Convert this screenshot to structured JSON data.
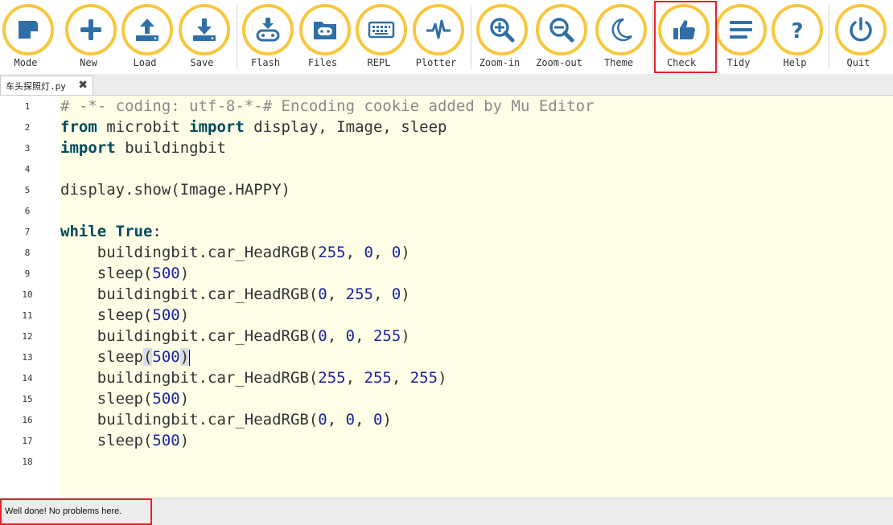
{
  "toolbar": {
    "buttons": [
      {
        "id": "mode",
        "label": "Mode",
        "icon": "mode-icon"
      },
      {
        "id": "new",
        "label": "New",
        "icon": "plus-icon"
      },
      {
        "id": "load",
        "label": "Load",
        "icon": "upload-icon"
      },
      {
        "id": "save",
        "label": "Save",
        "icon": "download-icon"
      },
      {
        "id": "flash",
        "label": "Flash",
        "icon": "flash-icon"
      },
      {
        "id": "files",
        "label": "Files",
        "icon": "folder-icon"
      },
      {
        "id": "repl",
        "label": "REPL",
        "icon": "keyboard-icon"
      },
      {
        "id": "plotter",
        "label": "Plotter",
        "icon": "pulse-icon"
      },
      {
        "id": "zoom-in",
        "label": "Zoom-in",
        "icon": "zoom-in-icon"
      },
      {
        "id": "zoom-out",
        "label": "Zoom-out",
        "icon": "zoom-out-icon"
      },
      {
        "id": "theme",
        "label": "Theme",
        "icon": "moon-icon"
      },
      {
        "id": "check",
        "label": "Check",
        "icon": "thumbs-up-icon"
      },
      {
        "id": "tidy",
        "label": "Tidy",
        "icon": "lines-icon"
      },
      {
        "id": "help",
        "label": "Help",
        "icon": "question-icon"
      },
      {
        "id": "quit",
        "label": "Quit",
        "icon": "power-icon"
      }
    ],
    "accent_color": "#f8c73d",
    "icon_color": "#2f6fa6",
    "highlight_color": "#e8202a"
  },
  "tab": {
    "filename": "车头探照灯.py",
    "close": "✖"
  },
  "editor": {
    "lines": [
      {
        "n": "1",
        "tokens": [
          {
            "t": "# -*- coding: utf-8-*-# Encoding cookie added by Mu Editor",
            "c": "cm"
          }
        ]
      },
      {
        "n": "2",
        "tokens": [
          {
            "t": "from",
            "c": "kw"
          },
          {
            "t": " microbit ",
            "c": ""
          },
          {
            "t": "import",
            "c": "kw"
          },
          {
            "t": " display, Image, sleep",
            "c": ""
          }
        ]
      },
      {
        "n": "3",
        "tokens": [
          {
            "t": "import",
            "c": "kw"
          },
          {
            "t": " buildingbit",
            "c": ""
          }
        ]
      },
      {
        "n": "4",
        "tokens": []
      },
      {
        "n": "5",
        "tokens": [
          {
            "t": "display.show(Image.HAPPY)",
            "c": ""
          }
        ]
      },
      {
        "n": "6",
        "tokens": []
      },
      {
        "n": "7",
        "tokens": [
          {
            "t": "while",
            "c": "kw"
          },
          {
            "t": " ",
            "c": ""
          },
          {
            "t": "True",
            "c": "kw"
          },
          {
            "t": ":",
            "c": ""
          }
        ]
      },
      {
        "n": "8",
        "tokens": [
          {
            "t": "    buildingbit.car_HeadRGB(",
            "c": ""
          },
          {
            "t": "255",
            "c": "num"
          },
          {
            "t": ", ",
            "c": ""
          },
          {
            "t": "0",
            "c": "num"
          },
          {
            "t": ", ",
            "c": ""
          },
          {
            "t": "0",
            "c": "num"
          },
          {
            "t": ")",
            "c": ""
          }
        ]
      },
      {
        "n": "9",
        "tokens": [
          {
            "t": "    sleep(",
            "c": ""
          },
          {
            "t": "500",
            "c": "num"
          },
          {
            "t": ")",
            "c": ""
          }
        ]
      },
      {
        "n": "10",
        "tokens": [
          {
            "t": "    buildingbit.car_HeadRGB(",
            "c": ""
          },
          {
            "t": "0",
            "c": "num"
          },
          {
            "t": ", ",
            "c": ""
          },
          {
            "t": "255",
            "c": "num"
          },
          {
            "t": ", ",
            "c": ""
          },
          {
            "t": "0",
            "c": "num"
          },
          {
            "t": ")",
            "c": ""
          }
        ]
      },
      {
        "n": "11",
        "tokens": [
          {
            "t": "    sleep(",
            "c": ""
          },
          {
            "t": "500",
            "c": "num"
          },
          {
            "t": ")",
            "c": ""
          }
        ]
      },
      {
        "n": "12",
        "tokens": [
          {
            "t": "    buildingbit.car_HeadRGB(",
            "c": ""
          },
          {
            "t": "0",
            "c": "num"
          },
          {
            "t": ", ",
            "c": ""
          },
          {
            "t": "0",
            "c": "num"
          },
          {
            "t": ", ",
            "c": ""
          },
          {
            "t": "255",
            "c": "num"
          },
          {
            "t": ")",
            "c": ""
          }
        ]
      },
      {
        "n": "13",
        "tokens": [
          {
            "t": "    sleep",
            "c": ""
          },
          {
            "t": "(",
            "c": "paren-hl"
          },
          {
            "t": "500",
            "c": "num"
          },
          {
            "t": ")",
            "c": "paren-hl"
          },
          {
            "t": "",
            "c": "caret"
          }
        ]
      },
      {
        "n": "14",
        "tokens": [
          {
            "t": "    buildingbit.car_HeadRGB(",
            "c": ""
          },
          {
            "t": "255",
            "c": "num"
          },
          {
            "t": ", ",
            "c": ""
          },
          {
            "t": "255",
            "c": "num"
          },
          {
            "t": ", ",
            "c": ""
          },
          {
            "t": "255",
            "c": "num"
          },
          {
            "t": ")",
            "c": ""
          }
        ]
      },
      {
        "n": "15",
        "tokens": [
          {
            "t": "    sleep(",
            "c": ""
          },
          {
            "t": "500",
            "c": "num"
          },
          {
            "t": ")",
            "c": ""
          }
        ]
      },
      {
        "n": "16",
        "tokens": [
          {
            "t": "    buildingbit.car_HeadRGB(",
            "c": ""
          },
          {
            "t": "0",
            "c": "num"
          },
          {
            "t": ", ",
            "c": ""
          },
          {
            "t": "0",
            "c": "num"
          },
          {
            "t": ", ",
            "c": ""
          },
          {
            "t": "0",
            "c": "num"
          },
          {
            "t": ")",
            "c": ""
          }
        ]
      },
      {
        "n": "17",
        "tokens": [
          {
            "t": "    sleep(",
            "c": ""
          },
          {
            "t": "500",
            "c": "num"
          },
          {
            "t": ")",
            "c": ""
          }
        ]
      },
      {
        "n": "18",
        "tokens": []
      }
    ]
  },
  "status": {
    "message": "Well done! No problems here."
  }
}
